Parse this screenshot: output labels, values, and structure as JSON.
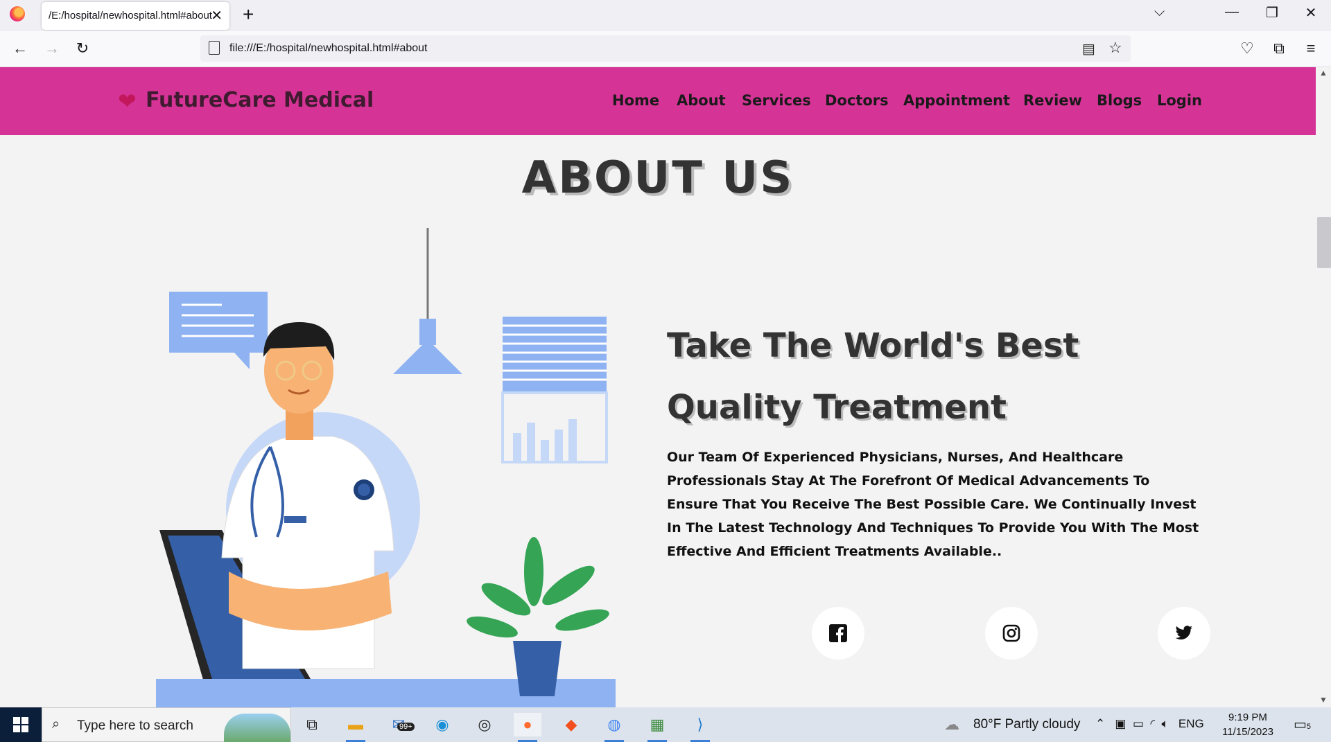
{
  "browser": {
    "tab_title": "/E:/hospital/newhospital.html#about",
    "tab_close": "✕",
    "new_tab": "+",
    "url": "file:///E:/hospital/newhospital.html#about"
  },
  "site": {
    "logo": "FutureCare Medical",
    "nav": [
      "Home",
      "About",
      "Services",
      "Doctors",
      "Appointment",
      "Review",
      "Blogs",
      "Login"
    ]
  },
  "about": {
    "section_title": "ABOUT US",
    "headline": "Take The World's Best Quality Treatment",
    "paragraph": "Our Team Of Experienced Physicians, Nurses, And Healthcare Professionals Stay At The Forefront Of Medical Advancements To Ensure That You Receive The Best Possible Care. We Continually Invest In The Latest Technology And Techniques To Provide You With The Most Effective And Efficient Treatments Available..",
    "socials": [
      "facebook-icon",
      "instagram-icon",
      "twitter-icon"
    ]
  },
  "taskbar": {
    "search_placeholder": "Type here to search",
    "mail_badge": "99+",
    "weather": "80°F  Partly cloudy",
    "language": "ENG",
    "time": "9:19 PM",
    "date": "11/15/2023",
    "notification_count": "5"
  },
  "colors": {
    "header": "#d63396",
    "logo_text": "#3f1b30",
    "taskbar": "#dce3ec"
  }
}
